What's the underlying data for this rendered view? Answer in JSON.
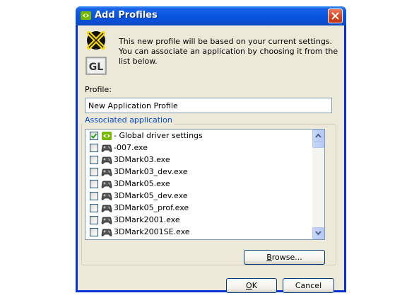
{
  "window": {
    "title": "Add Profiles",
    "title_icon": "nvidia-eye-icon",
    "close_icon": "close-icon"
  },
  "info_text": "This new profile will be based on your current settings. You can associate an application by choosing it from the list below.",
  "app_icon": "opengl-badge-icon",
  "app_icon_text": "GL",
  "profile": {
    "label": "Profile:",
    "value": "New Application Profile"
  },
  "associated": {
    "legend": "Associated application",
    "items": [
      {
        "label": "- Global driver settings",
        "checked": true,
        "icon": "nvidia-eye-icon"
      },
      {
        "label": "-007.exe",
        "checked": false,
        "icon": "gamepad-icon"
      },
      {
        "label": "3DMark03.exe",
        "checked": false,
        "icon": "gamepad-icon"
      },
      {
        "label": "3DMark03_dev.exe",
        "checked": false,
        "icon": "gamepad-icon"
      },
      {
        "label": "3DMark05.exe",
        "checked": false,
        "icon": "gamepad-icon"
      },
      {
        "label": "3DMark05_dev.exe",
        "checked": false,
        "icon": "gamepad-icon"
      },
      {
        "label": "3DMark05_prof.exe",
        "checked": false,
        "icon": "gamepad-icon"
      },
      {
        "label": "3DMark2001.exe",
        "checked": false,
        "icon": "gamepad-icon"
      },
      {
        "label": "3DMark2001SE.exe",
        "checked": false,
        "icon": "gamepad-icon"
      }
    ]
  },
  "buttons": {
    "browse": "Browse...",
    "ok": "OK",
    "cancel": "Cancel"
  }
}
